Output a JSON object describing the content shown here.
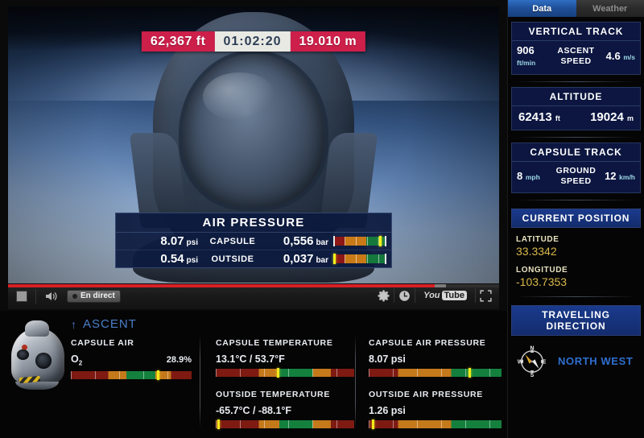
{
  "overlay": {
    "altitude_ft": "62,367 ft",
    "mission_clock": "01:02:20",
    "altitude_m": "19.010 m"
  },
  "air_pressure": {
    "title": "AIR PRESSURE",
    "rows": [
      {
        "psi": "8.07",
        "psi_unit": "psi",
        "label": "CAPSULE",
        "bar": "0,556",
        "bar_unit": "bar",
        "needle_pct": 88
      },
      {
        "psi": "0.54",
        "psi_unit": "psi",
        "label": "OUTSIDE",
        "bar": "0,037",
        "bar_unit": "bar",
        "needle_pct": 2
      }
    ]
  },
  "player": {
    "stop_label": "stop-button",
    "volume_label": "volume-icon",
    "live_label": "En direct",
    "settings_label": "settings-icon",
    "clock_label": "clock-icon",
    "youtube_you": "You",
    "youtube_tube": "Tube",
    "fullscreen_label": "fullscreen-icon",
    "progress_pct": 87
  },
  "bottom": {
    "status": "ASCENT",
    "status_arrow": "↑",
    "capsule_air": {
      "label": "CAPSULE AIR",
      "gas": "O",
      "gas_sub": "2",
      "value": "28.9%",
      "needle_pct": 72
    },
    "capsule_temperature": {
      "label": "CAPSULE TEMPERATURE",
      "value": "13.1°C / 53.7°F",
      "needle_pct": 45
    },
    "outside_temperature": {
      "label": "OUTSIDE TEMPERATURE",
      "value": "-65.7°C / -88.1°F",
      "needle_pct": 2
    },
    "capsule_air_pressure": {
      "label": "CAPSULE AIR PRESSURE",
      "value": "8.07 psi",
      "needle_pct": 76
    },
    "outside_air_pressure": {
      "label": "OUTSIDE AIR PRESSURE",
      "value": "1.26 psi",
      "needle_pct": 3
    }
  },
  "sidebar": {
    "tabs": [
      {
        "label": "Data",
        "active": true
      },
      {
        "label": "Weather",
        "active": false
      }
    ],
    "vertical_track": {
      "title": "VERTICAL TRACK",
      "left_value": "906",
      "left_unit": "ft/min",
      "center_label": "ASCENT SPEED",
      "right_value": "4.6",
      "right_unit": "m/s"
    },
    "altitude": {
      "title": "ALTITUDE",
      "left_value": "62413",
      "left_unit": "ft",
      "right_value": "19024",
      "right_unit": "m"
    },
    "capsule_track": {
      "title": "CAPSULE TRACK",
      "left_value": "8",
      "left_unit": "mph",
      "center_label": "GROUND SPEED",
      "right_value": "12",
      "right_unit": "km/h"
    },
    "current_position": {
      "title": "CURRENT POSITION",
      "latitude_label": "LATITUDE",
      "latitude_value": "33.3342",
      "longitude_label": "LONGITUDE",
      "longitude_value": "-103.7353"
    },
    "travelling_direction": {
      "title": "TRAVELLING DIRECTION",
      "direction": "NORTH WEST",
      "compass_n": "N",
      "compass_e": "E",
      "compass_s": "S",
      "compass_w": "W"
    }
  },
  "colors": {
    "accent_red": "#cc1f4a",
    "accent_blue": "#2f6fd0",
    "panel_navy": "#0c1640",
    "gold": "#d9b84a",
    "gauge_green": "#14803e",
    "gauge_orange": "#c4791b",
    "gauge_red": "#7e1a12",
    "needle_yellow": "#f3ea1b"
  }
}
